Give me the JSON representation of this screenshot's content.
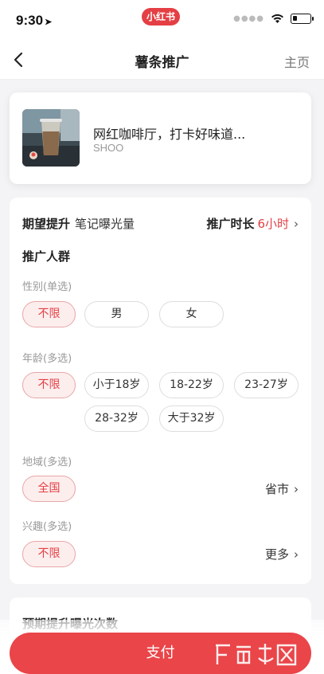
{
  "status_bar": {
    "time": "9:30",
    "app_badge": "小红书"
  },
  "nav": {
    "title": "薯条推广",
    "home_label": "主页"
  },
  "post": {
    "title": "网红咖啡厅，打卡好味道...",
    "author": "SHOO"
  },
  "settings": {
    "goal_label": "期望提升",
    "goal_value": "笔记曝光量",
    "duration_label": "推广时长",
    "duration_value": "6小时",
    "audience_title": "推广人群",
    "gender": {
      "label": "性别(单选)",
      "options": [
        "不限",
        "男",
        "女"
      ],
      "selected": "不限"
    },
    "age": {
      "label": "年龄(多选)",
      "options": [
        "不限",
        "小于18岁",
        "18-22岁",
        "23-27岁",
        "28-32岁",
        "大于32岁"
      ],
      "selected": "不限"
    },
    "region": {
      "label": "地域(多选)",
      "selected": "全国",
      "more_label": "省市"
    },
    "interest": {
      "label": "兴趣(多选)",
      "selected": "不限",
      "more_label": "更多"
    }
  },
  "next_section": {
    "title": "预期提升曝光次数"
  },
  "footer": {
    "pay_label": "支付"
  },
  "colors": {
    "accent": "#e43f44",
    "selected_bg": "#fdeeee"
  }
}
